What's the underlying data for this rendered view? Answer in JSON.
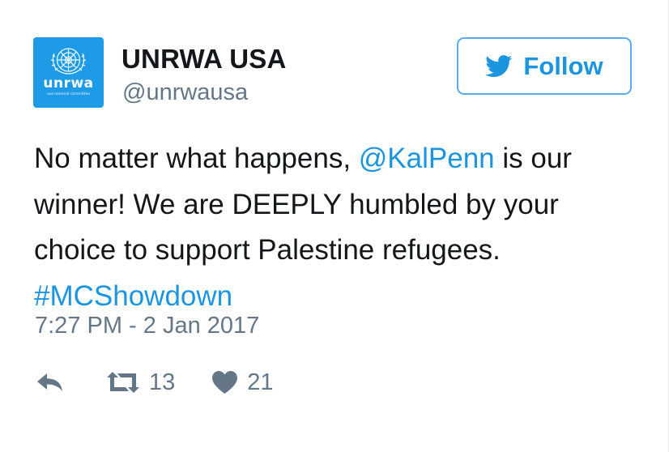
{
  "author": {
    "display_name": "UNRWA USA",
    "handle": "@unrwausa",
    "avatar": {
      "wordmark": "unrwa",
      "subline": "usa national committee",
      "icon": "un-emblem-icon",
      "background": "#1d9be6"
    }
  },
  "follow_button": {
    "label": "Follow",
    "icon": "twitter-bird-icon",
    "color": "#1b95e0"
  },
  "tweet": {
    "line1_prefix": "No matter what happens, ",
    "mention": "@KalPenn",
    "line1_suffix": " is our",
    "line2": "winner! We are DEEPLY humbled by your",
    "line3": "choice to support Palestine refugees.",
    "hashtag": "#MCShowdown",
    "link_color": "#1b95e0"
  },
  "timestamp": "7:27 PM - 2 Jan 2017",
  "actions": {
    "reply": {
      "icon": "reply-icon"
    },
    "retweet": {
      "icon": "retweet-icon",
      "count": "13"
    },
    "like": {
      "icon": "heart-icon",
      "count": "21"
    }
  }
}
